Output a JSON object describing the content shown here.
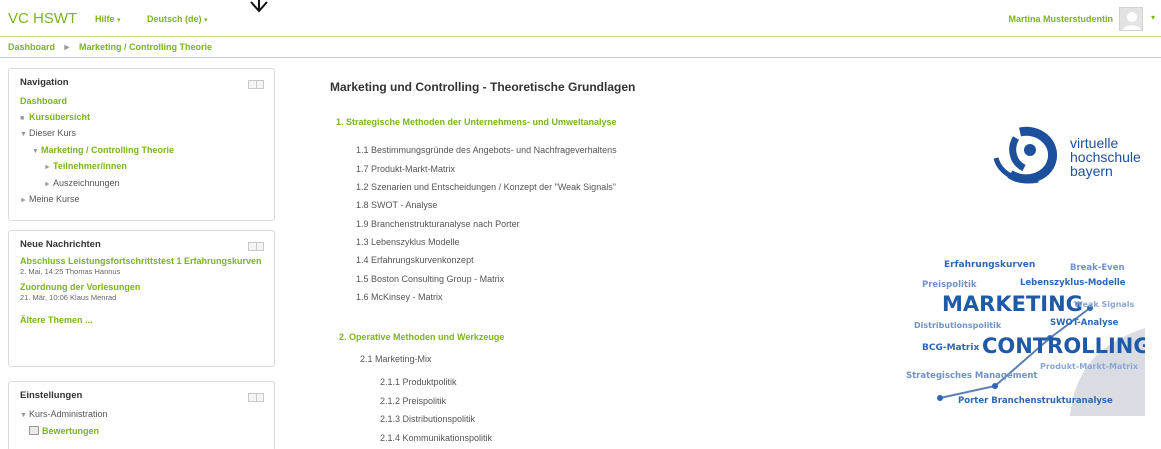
{
  "header": {
    "brand": "VC HSWT",
    "help_menu": "Hilfe",
    "language_menu": "Deutsch (de)",
    "user_name": "Martina Musterstudentin"
  },
  "breadcrumb": {
    "items": [
      "Dashboard",
      "Marketing / Controlling Theorie"
    ]
  },
  "navigation": {
    "title": "Navigation",
    "dashboard": "Dashboard",
    "course_overview": "Kursübersicht",
    "this_course": "Dieser Kurs",
    "course": "Marketing / Controlling Theorie",
    "participants": "Teilnehmer/innen",
    "badges": "Auszeichnungen",
    "my_courses": "Meine Kurse"
  },
  "news": {
    "title": "Neue Nachrichten",
    "items": [
      {
        "title": "Abschluss Leistungsfortschrittstest 1 Erfahrungskurven",
        "meta": "2. Mai, 14:25  Thomas Hannus"
      },
      {
        "title": "Zuordnung der Vorlesungen",
        "meta": "21. Mär, 10:06  Klaus Menrad"
      }
    ],
    "older": "Ältere Themen ..."
  },
  "settings": {
    "title": "Einstellungen",
    "course_admin": "Kurs-Administration",
    "grades": "Bewertungen"
  },
  "main": {
    "title": "Marketing und Controlling - Theoretische Grundlagen",
    "section1": {
      "title": "1. Strategische Methoden der Unternehmens- und Umweltanalyse",
      "items": [
        "1.1 Bestimmungsgründe des Angebots- und Nachfrageverhaltens",
        "1.7 Produkt-Markt-Matrix",
        "1.2 Szenarien und Entscheidungen / Konzept der \"Weak Signals\"",
        "1.8 SWOT - Analyse",
        "1.9 Branchenstrukturanalyse nach Porter",
        "1.3 Lebenszyklus Modelle",
        "1.4 Erfahrungskurvenkonzept",
        "1.5 Boston Consulting Group - Matrix",
        "1.6 McKinsey - Matrix"
      ]
    },
    "section2": {
      "title": "2. Operative Methoden und Werkzeuge",
      "item": "2.1 Marketing-Mix",
      "subitems": [
        "2.1.1 Produktpolitik",
        "2.1.2 Preispolitik",
        "2.1.3 Distributionspolitik",
        "2.1.4 Kommunikationspolitik"
      ]
    }
  },
  "logo": {
    "lines": [
      "virtuelle",
      "hochschule",
      "bayern"
    ]
  },
  "word_cloud": {
    "words": [
      "Erfahrungskurven",
      "Break-Even",
      "Preispolitik",
      "Lebenszyklus-Modelle",
      "MARKETING",
      "Weak Signals",
      "Distributionspolitik",
      "SWOT-Analyse",
      "BCG-Matrix",
      "CONTROLLING",
      "Strategisches Management",
      "Produkt-Markt-Matrix",
      "Porter Branchenstrukturanalyse"
    ]
  }
}
